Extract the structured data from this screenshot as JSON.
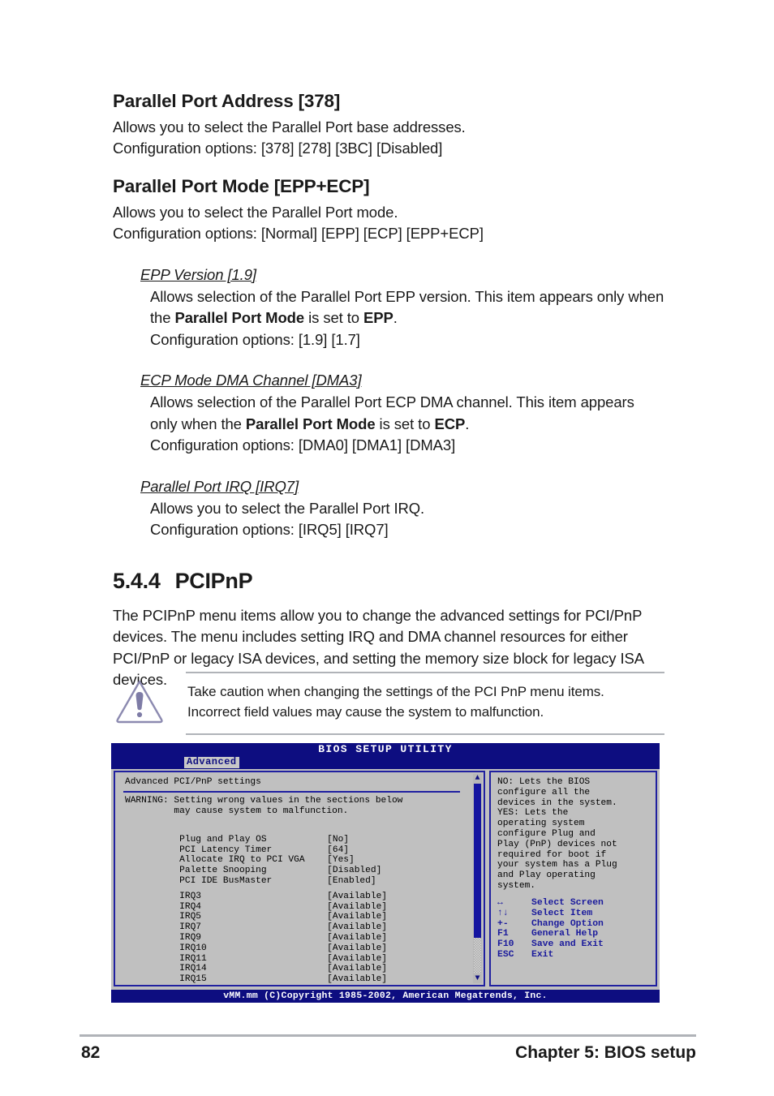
{
  "sections": [
    {
      "heading": "Parallel Port Address [378]",
      "desc": "Allows you to select the Parallel Port base addresses.",
      "config": "Configuration options: [378] [278] [3BC] [Disabled]"
    },
    {
      "heading": "Parallel Port Mode [EPP+ECP]",
      "desc": "Allows you to select the Parallel Port mode.",
      "config": "Configuration options: [Normal] [EPP] [ECP] [EPP+ECP]"
    }
  ],
  "subsections": [
    {
      "heading": "EPP Version [1.9]",
      "body_1": "Allows selection of the Parallel Port EPP version. This item appears only when the ",
      "bold_1": "Parallel Port Mode",
      "body_2": " is set to ",
      "bold_2": "EPP",
      "body_3": ".",
      "config": "Configuration options: [1.9] [1.7]"
    },
    {
      "heading": "ECP Mode DMA Channel [DMA3]",
      "body_1": "Allows selection of the Parallel Port ECP DMA channel. This item appears only when the ",
      "bold_1": "Parallel Port Mode",
      "body_2": " is set to ",
      "bold_2": "ECP",
      "body_3": ".",
      "config": "Configuration options: [DMA0] [DMA1] [DMA3]"
    },
    {
      "heading": "Parallel Port IRQ [IRQ7]",
      "body_1": "Allows you to select the Parallel Port IRQ.",
      "config": "Configuration options: [IRQ5] [IRQ7]"
    }
  ],
  "chapter_section": {
    "number": "5.4.4",
    "title": "PCIPnP",
    "paragraph": "The PCIPnP menu items allow you to change the advanced settings for PCI/PnP devices. The menu includes setting IRQ and DMA channel resources for either PCI/PnP or legacy ISA devices, and setting the memory size block for legacy ISA devices."
  },
  "note": {
    "icon": "caution-triangle-icon",
    "icon_color": "#8c8ab0",
    "text": "Take caution when changing the settings of the PCI PnP menu items. Incorrect field values may cause the system to malfunction."
  },
  "bios": {
    "title": "BIOS SETUP UTILITY",
    "tab": "Advanced",
    "panel_title": "Advanced PCI/PnP settings",
    "warning": "WARNING: Setting wrong values in the sections below\n         may cause system to malfunction.",
    "settings": [
      {
        "label": "Plug and Play OS",
        "value": "[No]"
      },
      {
        "label": "PCI Latency Timer",
        "value": "[64]"
      },
      {
        "label": "Allocate IRQ to PCI VGA",
        "value": "[Yes]"
      },
      {
        "label": "Palette Snooping",
        "value": "[Disabled]"
      },
      {
        "label": "PCI IDE BusMaster",
        "value": "[Enabled]"
      }
    ],
    "irqs": [
      {
        "label": "IRQ3",
        "value": "[Available]"
      },
      {
        "label": "IRQ4",
        "value": "[Available]"
      },
      {
        "label": "IRQ5",
        "value": "[Available]"
      },
      {
        "label": "IRQ7",
        "value": "[Available]"
      },
      {
        "label": "IRQ9",
        "value": "[Available]"
      },
      {
        "label": "IRQ10",
        "value": "[Available]"
      },
      {
        "label": "IRQ11",
        "value": "[Available]"
      },
      {
        "label": "IRQ14",
        "value": "[Available]"
      },
      {
        "label": "IRQ15",
        "value": "[Available]"
      }
    ],
    "help_text": "NO: Lets the BIOS\nconfigure all the\ndevices in the system.\nYES: Lets the\noperating system\nconfigure Plug and\nPlay (PnP) devices not\nrequired for boot if\nyour system has a Plug\nand Play operating\nsystem.",
    "keys": [
      {
        "key": "↔",
        "action": "Select Screen"
      },
      {
        "key": "↑↓",
        "action": "Select Item"
      },
      {
        "key": "+-",
        "action": "Change Option"
      },
      {
        "key": "F1",
        "action": "General Help"
      },
      {
        "key": "F10",
        "action": "Save and Exit"
      },
      {
        "key": "ESC",
        "action": "Exit"
      }
    ],
    "scroll_up_glyph": "▲",
    "scroll_down_glyph": "▼",
    "footer": "vMM.mm (C)Copyright 1985-2002, American Megatrends, Inc.",
    "accent_blue": "#0d0d80",
    "panel_bg": "#c0c0c0"
  },
  "page_footer": {
    "page_number": "82",
    "chapter": "Chapter 5: BIOS setup"
  }
}
